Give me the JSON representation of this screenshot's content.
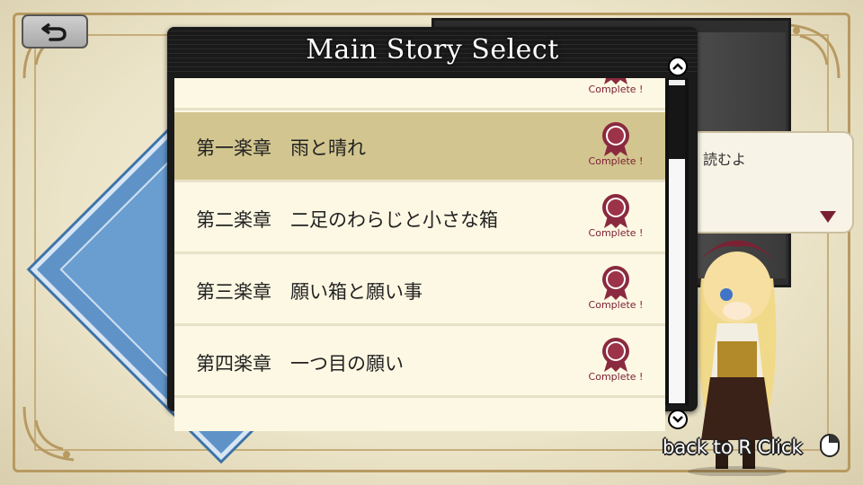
{
  "panel": {
    "title": "Main Story Select"
  },
  "chapters": [
    {
      "label": "",
      "badge": "Complete !",
      "selected": false
    },
    {
      "label": "第一楽章　雨と晴れ",
      "badge": "Complete !",
      "selected": true
    },
    {
      "label": "第二楽章　二足のわらじと小さな箱",
      "badge": "Complete !",
      "selected": false
    },
    {
      "label": "第三楽章　願い箱と願い事",
      "badge": "Complete !",
      "selected": false
    },
    {
      "label": "第四楽章　一つ目の願い",
      "badge": "Complete !",
      "selected": false
    }
  ],
  "background": {
    "speech_text": "読むよ"
  },
  "hint": {
    "text": "back to R Click",
    "icon": "mouse-icon"
  },
  "icons": {
    "back": "back-arrow-icon",
    "scroll_up": "chevron-up-icon",
    "scroll_down": "chevron-down-icon",
    "badge": "ribbon-rosette-icon"
  },
  "colors": {
    "selected_row": "#d2c58f",
    "row": "#fdf8e3",
    "badge": "#8a2a3f"
  }
}
